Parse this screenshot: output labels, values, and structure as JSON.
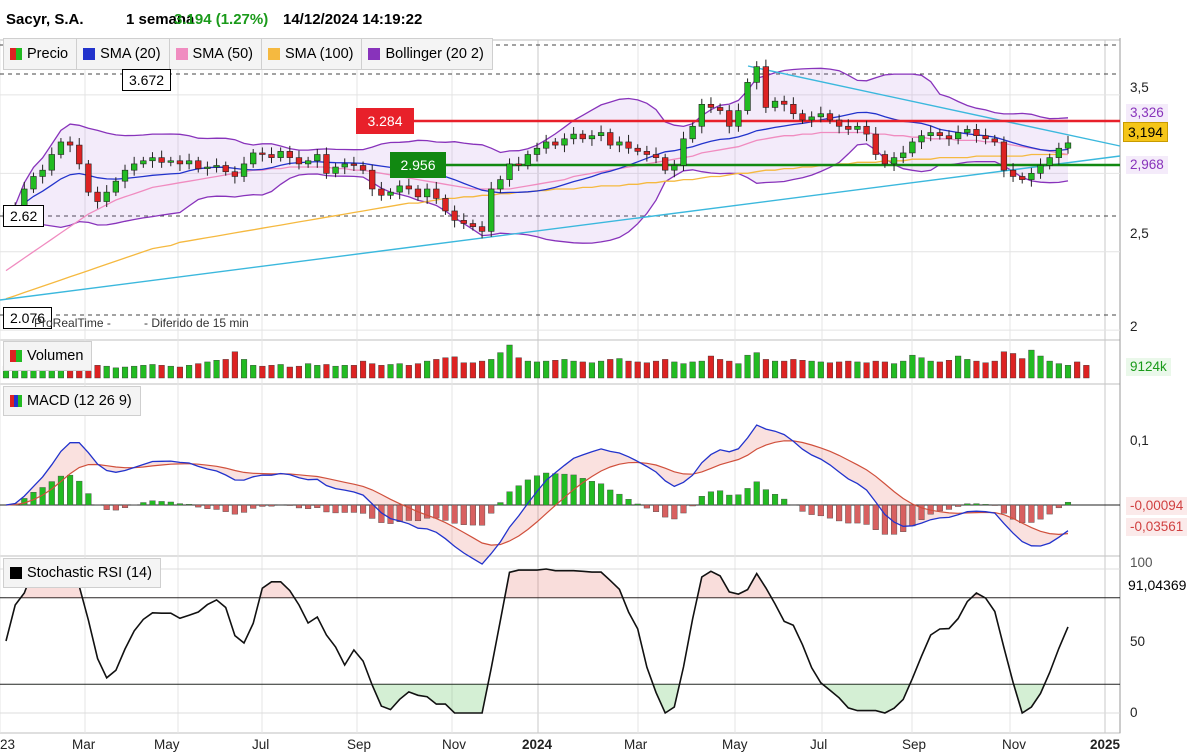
{
  "header": {
    "instrument": "Sacyr, S.A.",
    "period": "1 semana",
    "change": "3.194 (1.27%)",
    "datetime": "14/12/2024 14:19:22"
  },
  "colors": {
    "up": "#22bb22",
    "down": "#dd2222",
    "sma20": "#2233cc",
    "sma50": "#f08cc0",
    "sma100": "#f5b940",
    "bollinger": "#8833bb",
    "trend": "#3bb8dd",
    "resistance": "#e8202a",
    "support": "#118811"
  },
  "price_panel": {
    "legend": [
      {
        "label": "Precio",
        "icon": "candle-icon"
      },
      {
        "label": "SMA (20)",
        "icon": "blue-square-icon"
      },
      {
        "label": "SMA (50)",
        "icon": "pink-square-icon"
      },
      {
        "label": "SMA (100)",
        "icon": "orange-square-icon"
      },
      {
        "label": "Bollinger (20 2)",
        "icon": "purple-square-icon"
      }
    ],
    "level_top": "3.672",
    "level_mid_low": "2.62",
    "level_bottom": "2.076",
    "resistance_label": "3.284",
    "support_label": "2.956",
    "watermark_source": "ProRealTime -",
    "watermark_delay": "- Diferido de 15 min",
    "y_ticks": [
      "3,5",
      "2,5",
      "2"
    ],
    "badge_upper": "3,326",
    "badge_price": "3,194",
    "badge_lower": "2,968"
  },
  "volume_panel": {
    "title": "Volumen",
    "value": "9124k"
  },
  "macd_panel": {
    "title": "MACD (12 26 9)",
    "tick": "0,1",
    "value1": "-0,00094",
    "value2": "-0,03561"
  },
  "stoch_panel": {
    "title": "Stochastic RSI (14)",
    "value": "91,04369",
    "ticks": [
      "100",
      "50",
      "0"
    ]
  },
  "x_axis": {
    "labels": [
      "23",
      "Mar",
      "May",
      "Jul",
      "Sep",
      "Nov",
      "2024",
      "Mar",
      "May",
      "Jul",
      "Sep",
      "Nov",
      "2025"
    ]
  },
  "chart_data": {
    "type": "line",
    "title": "Sacyr, S.A. 1 semana",
    "price_ylim": [
      1.95,
      3.85
    ],
    "close": [
      2.75,
      2.78,
      2.9,
      2.98,
      3.02,
      3.12,
      3.2,
      3.18,
      3.06,
      2.88,
      2.82,
      2.88,
      2.95,
      3.02,
      3.06,
      3.08,
      3.1,
      3.07,
      3.08,
      3.06,
      3.08,
      3.03,
      3.04,
      3.05,
      3.01,
      2.98,
      3.06,
      3.13,
      3.12,
      3.1,
      3.14,
      3.1,
      3.06,
      3.08,
      3.12,
      3.0,
      3.04,
      3.06,
      3.05,
      3.02,
      2.9,
      2.86,
      2.88,
      2.92,
      2.9,
      2.85,
      2.9,
      2.84,
      2.76,
      2.7,
      2.68,
      2.66,
      2.63,
      2.9,
      2.96,
      3.06,
      3.05,
      3.12,
      3.16,
      3.2,
      3.18,
      3.22,
      3.25,
      3.22,
      3.24,
      3.26,
      3.18,
      3.2,
      3.16,
      3.14,
      3.12,
      3.1,
      3.02,
      3.05,
      3.22,
      3.3,
      3.44,
      3.42,
      3.4,
      3.3,
      3.4,
      3.58,
      3.68,
      3.42,
      3.46,
      3.44,
      3.38,
      3.34,
      3.36,
      3.38,
      3.34,
      3.3,
      3.28,
      3.3,
      3.25,
      3.12,
      3.06,
      3.1,
      3.13,
      3.2,
      3.24,
      3.26,
      3.24,
      3.22,
      3.26,
      3.28,
      3.24,
      3.22,
      3.2,
      3.02,
      2.98,
      2.96,
      3.0,
      3.05,
      3.1,
      3.16,
      3.194
    ],
    "sma50": [
      2.38,
      2.42,
      2.46,
      2.5,
      2.54,
      2.58,
      2.62,
      2.66,
      2.7,
      2.74,
      2.77,
      2.8,
      2.83,
      2.85,
      2.87,
      2.89,
      2.91,
      2.92,
      2.93,
      2.94,
      2.95,
      2.96,
      2.97,
      2.98,
      2.99,
      3.0,
      3.01,
      3.02,
      3.02,
      3.03,
      3.03,
      3.04,
      3.04,
      3.04,
      3.04,
      3.04,
      3.03,
      3.03,
      3.02,
      3.02,
      3.01,
      3.0,
      2.99,
      2.98,
      2.97,
      2.96,
      2.95,
      2.94,
      2.93,
      2.92,
      2.91,
      2.9,
      2.9,
      2.9,
      2.9,
      2.9,
      2.91,
      2.92,
      2.93,
      2.94,
      2.95,
      2.96,
      2.98,
      2.99,
      3.0,
      3.01,
      3.02,
      3.03,
      3.04,
      3.05,
      3.06,
      3.07,
      3.08,
      3.09,
      3.1,
      3.11,
      3.13,
      3.14,
      3.15,
      3.16,
      3.17,
      3.19,
      3.21,
      3.22,
      3.23,
      3.24,
      3.24,
      3.25,
      3.25,
      3.26,
      3.26,
      3.26,
      3.26,
      3.26,
      3.26,
      3.25,
      3.25,
      3.24,
      3.24,
      3.23,
      3.23,
      3.22,
      3.22,
      3.22,
      3.21,
      3.21,
      3.21,
      3.2,
      3.2,
      3.19,
      3.18,
      3.17,
      3.16,
      3.15,
      3.14,
      3.13,
      3.12
    ],
    "sma100": [
      2.2,
      2.22,
      2.24,
      2.26,
      2.28,
      2.3,
      2.32,
      2.34,
      2.36,
      2.38,
      2.4,
      2.42,
      2.44,
      2.46,
      2.48,
      2.5,
      2.52,
      2.53,
      2.54,
      2.56,
      2.57,
      2.58,
      2.59,
      2.6,
      2.61,
      2.62,
      2.63,
      2.64,
      2.65,
      2.66,
      2.67,
      2.68,
      2.69,
      2.7,
      2.71,
      2.72,
      2.73,
      2.74,
      2.75,
      2.76,
      2.77,
      2.78,
      2.79,
      2.8,
      2.81,
      2.81,
      2.82,
      2.83,
      2.84,
      2.84,
      2.85,
      2.85,
      2.86,
      2.86,
      2.87,
      2.87,
      2.88,
      2.88,
      2.89,
      2.89,
      2.9,
      2.9,
      2.9,
      2.91,
      2.91,
      2.92,
      2.92,
      2.92,
      2.93,
      2.93,
      2.94,
      2.94,
      2.95,
      2.95,
      2.96,
      2.96,
      2.97,
      2.98,
      2.98,
      2.99,
      3.0,
      3.0,
      3.01,
      3.02,
      3.02,
      3.03,
      3.03,
      3.04,
      3.04,
      3.05,
      3.05,
      3.06,
      3.06,
      3.07,
      3.07,
      3.07,
      3.08,
      3.08,
      3.08,
      3.09,
      3.09,
      3.09,
      3.1,
      3.1,
      3.1,
      3.1,
      3.11,
      3.11,
      3.11,
      3.11,
      3.11,
      3.11,
      3.12,
      3.12,
      3.12,
      3.12,
      3.12
    ],
    "volume": [
      28,
      30,
      22,
      26,
      30,
      34,
      40,
      36,
      32,
      30,
      30,
      28,
      24,
      26,
      28,
      30,
      32,
      30,
      28,
      26,
      30,
      34,
      38,
      42,
      44,
      62,
      44,
      30,
      28,
      30,
      32,
      26,
      28,
      34,
      30,
      32,
      28,
      30,
      30,
      40,
      34,
      30,
      32,
      34,
      30,
      34,
      40,
      44,
      48,
      50,
      36,
      36,
      40,
      44,
      60,
      78,
      48,
      40,
      38,
      40,
      42,
      44,
      40,
      38,
      36,
      40,
      44,
      46,
      40,
      38,
      36,
      40,
      44,
      38,
      34,
      38,
      40,
      52,
      44,
      40,
      34,
      54,
      60,
      44,
      40,
      40,
      44,
      42,
      40,
      38,
      36,
      38,
      40,
      38,
      36,
      40,
      38,
      34,
      40,
      54,
      48,
      40,
      38,
      42,
      52,
      44,
      40,
      36,
      40,
      62,
      58,
      46,
      66,
      52,
      40,
      34,
      30,
      38,
      30
    ]
  }
}
